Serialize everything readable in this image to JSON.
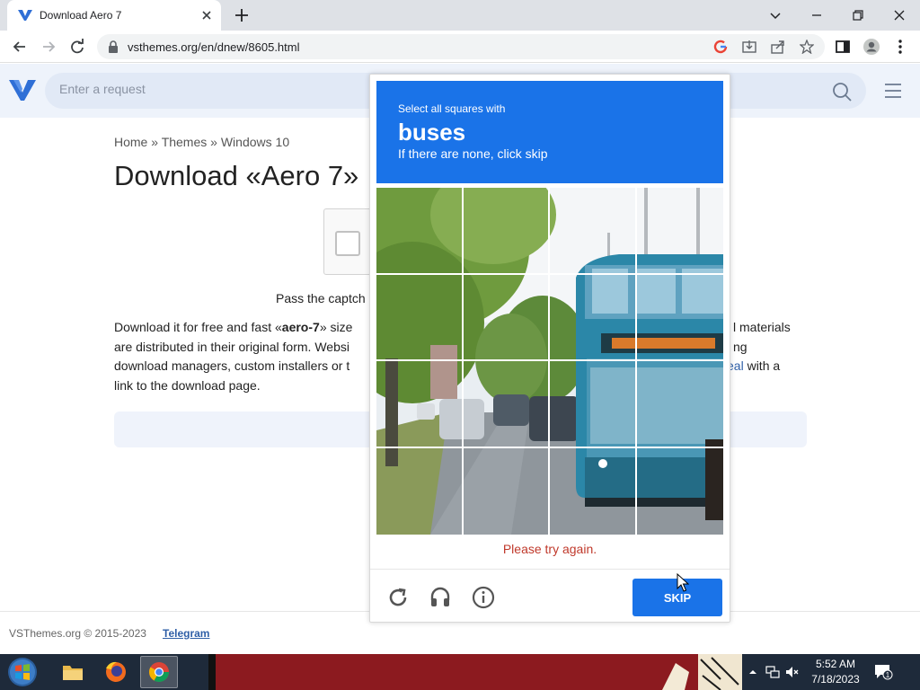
{
  "browser": {
    "tab_title": "Download Aero 7",
    "url": "vsthemes.org/en/dnew/8605.html"
  },
  "site": {
    "search_placeholder": "Enter a request",
    "breadcrumb": {
      "home": "Home",
      "sep": "»",
      "themes": "Themes",
      "windows": "Windows 10"
    },
    "title": "Download «Aero 7»",
    "pass_captcha": "Pass the captch",
    "desc": {
      "line1_a": "Download it for free and fast «",
      "line1_b": "aero-7",
      "line1_c": "» size",
      "line1_right": "l materials",
      "line2_left": "are distributed in their original form. Websi",
      "line2_right": "ng",
      "line3_left": "download managers, custom installers or t",
      "line3_link": "eal",
      "line3_right": " with a",
      "line4": "link to the download page."
    },
    "footer_copy": "VSThemes.org © 2015-2023",
    "footer_link": "Telegram"
  },
  "captcha": {
    "instruction": "Select all squares with",
    "target": "buses",
    "hint": "If there are none, click skip",
    "error": "Please try again.",
    "skip_label": "SKIP",
    "accent": "#1a73e8"
  },
  "taskbar": {
    "time": "5:52 AM",
    "date": "7/18/2023",
    "notification_count": "1"
  }
}
